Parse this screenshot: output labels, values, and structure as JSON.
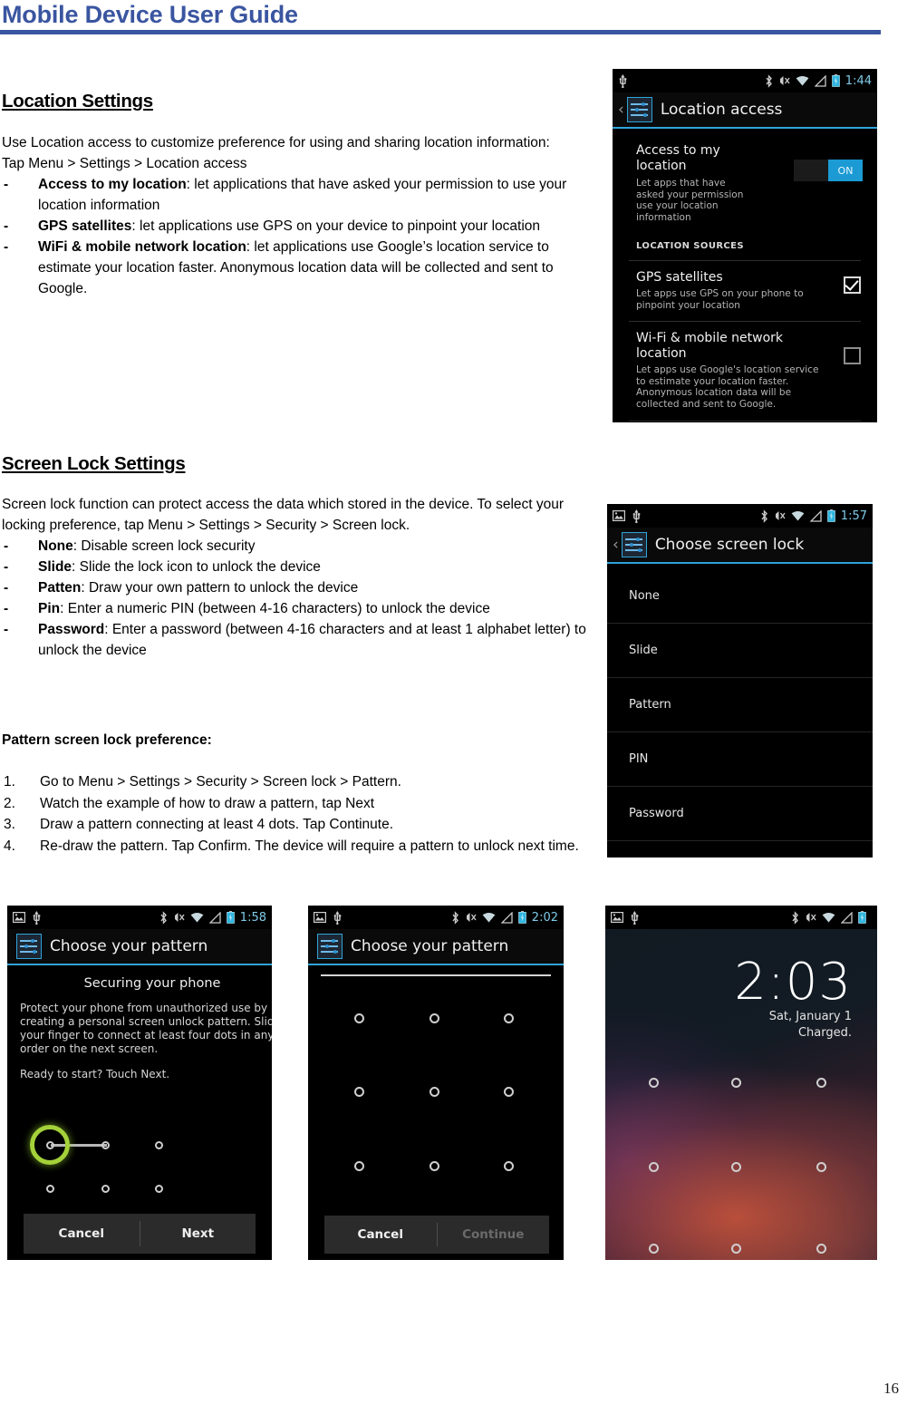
{
  "document": {
    "title": "Mobile Device User Guide",
    "page_number": "16",
    "accent_color": "#3a55a0"
  },
  "location_section": {
    "heading": "Location Settings",
    "intro_line1": "Use Location access to customize preference for using and sharing location information:",
    "intro_line2": "Tap Menu > Settings > Location access",
    "bullets": [
      {
        "marker": "-",
        "term": "Access to my location",
        "desc": ": let applications that have asked your permission to use your location information"
      },
      {
        "marker": "-",
        "term": "GPS satellites",
        "desc": ": let applications use GPS on your device to pinpoint your location"
      },
      {
        "marker": "-",
        "term": "WiFi & mobile network location",
        "desc": ": let applications use Google’s location service to estimate your location faster. Anonymous location data will be collected and sent to Google."
      }
    ]
  },
  "screenlock_section": {
    "heading": "Screen Lock Settings",
    "intro": "Screen lock function can protect access the data which stored in the device. To select your locking preference, tap Menu > Settings > Security > Screen lock.",
    "bullets": [
      {
        "marker": "-",
        "term": "None",
        "desc": ": Disable screen lock security"
      },
      {
        "marker": "-",
        "term": "Slide",
        "desc": ": Slide the lock icon to unlock the device"
      },
      {
        "marker": "-",
        "term": "Patten",
        "desc": ": Draw your own pattern to unlock the device"
      },
      {
        "marker": "-",
        "term": "Pin",
        "desc": ": Enter a numeric PIN (between 4-16 characters) to unlock the device"
      },
      {
        "marker": "-",
        "term": "Password",
        "desc": ": Enter a password (between 4-16 characters and at least 1 alphabet letter) to unlock the device"
      }
    ],
    "pattern_pref_heading": "Pattern screen lock preference:",
    "steps": [
      {
        "num": "1.",
        "text": "Go to Menu > Settings > Security > Screen lock > Pattern."
      },
      {
        "num": "2.",
        "text": "Watch the example of how to draw a pattern, tap Next"
      },
      {
        "num": "3.",
        "text": "Draw a pattern connecting at least 4 dots. Tap Continute."
      },
      {
        "num": "4.",
        "text": "Re-draw the pattern. Tap Confirm. The device will require a pattern to unlock next time."
      }
    ]
  },
  "screenshots": {
    "location_access": {
      "status_time": "1:44",
      "status_icons": [
        "usb-icon",
        "bluetooth-icon",
        "vibrate-mute-icon",
        "wifi-icon",
        "signal-icon",
        "battery-icon"
      ],
      "title": "Location access",
      "access_title": "Access to my location",
      "access_sub": "Let apps that have asked your permission use your location information",
      "toggle_label": "ON",
      "section_label": "LOCATION SOURCES",
      "gps_title": "GPS satellites",
      "gps_sub": "Let apps use GPS on your phone to pinpoint your location",
      "wifi_title": "Wi-Fi & mobile network location",
      "wifi_sub": "Let apps use Google's location service to estimate your location faster. Anonymous location data will be collected and sent to Google."
    },
    "choose_screen_lock": {
      "status_time": "1:57",
      "title": "Choose screen lock",
      "items": [
        "None",
        "Slide",
        "Pattern",
        "PIN",
        "Password"
      ]
    },
    "securing_phone": {
      "status_time": "1:58",
      "title": "Choose your pattern",
      "head": "Securing your phone",
      "body": "Protect your phone from unauthorized use by creating a personal screen unlock pattern. Slide your finger to connect at least four dots in any order on the next screen.",
      "ready": "Ready to start? Touch Next.",
      "cancel": "Cancel",
      "next": "Next"
    },
    "draw_pattern": {
      "status_time": "2:02",
      "title": "Choose your pattern",
      "cancel": "Cancel",
      "continue": "Continue"
    },
    "lock_screen": {
      "status_time": "",
      "clock": "2:03",
      "date": "Sat, January 1",
      "charge_status": "Charged."
    }
  }
}
